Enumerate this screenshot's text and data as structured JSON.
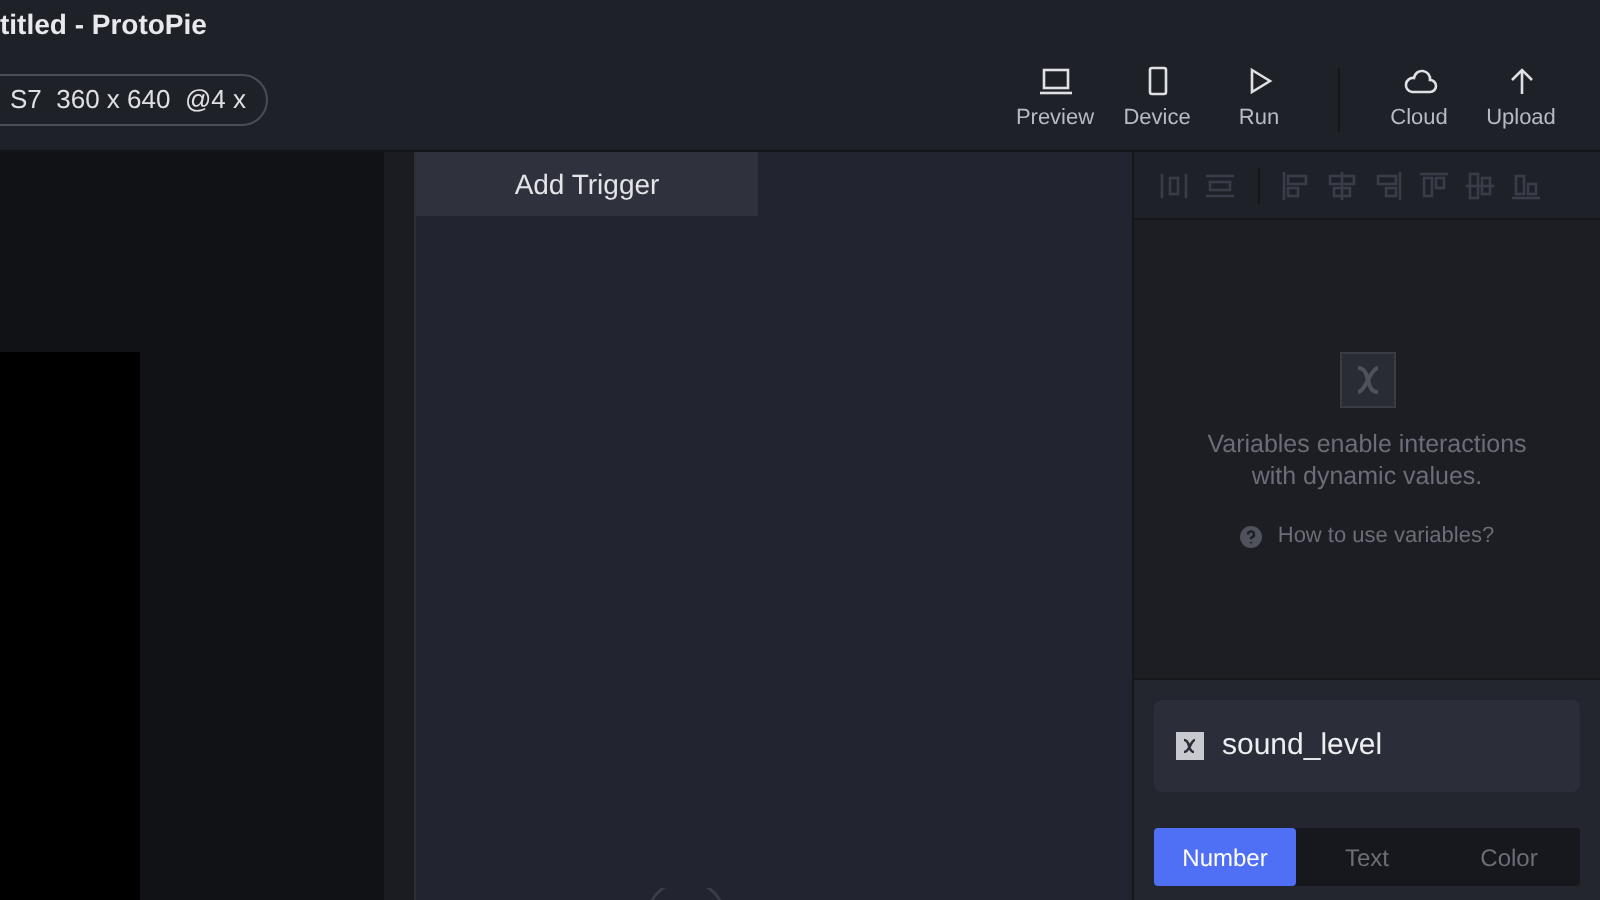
{
  "window": {
    "title": "titled - ProtoPie"
  },
  "device": {
    "label": "S7  360 x 640  @4 x"
  },
  "toolbar": [
    {
      "kind": "preview",
      "label": "Preview"
    },
    {
      "kind": "device",
      "label": "Device"
    },
    {
      "kind": "run",
      "label": "Run"
    },
    {
      "kind": "divider"
    },
    {
      "kind": "cloud",
      "label": "Cloud"
    },
    {
      "kind": "upload",
      "label": "Upload"
    }
  ],
  "triggers": {
    "add_button": "Add Trigger"
  },
  "align_tools": [
    {
      "kind": "distribute-h",
      "disabled": true
    },
    {
      "kind": "distribute-v",
      "disabled": true
    },
    {
      "kind": "divider"
    },
    {
      "kind": "left",
      "disabled": true
    },
    {
      "kind": "center-h",
      "disabled": true
    },
    {
      "kind": "right",
      "disabled": true
    },
    {
      "kind": "top",
      "disabled": true
    },
    {
      "kind": "center-v",
      "disabled": true
    },
    {
      "kind": "bottom",
      "disabled": true
    }
  ],
  "variables": {
    "empty_text": "Variables enable interactions with dynamic values.",
    "help_link": "How to use variables?",
    "variable_name": "sound_level",
    "types": [
      {
        "label": "Number",
        "selected": true
      },
      {
        "label": "Text",
        "selected": false
      },
      {
        "label": "Color",
        "selected": false
      }
    ]
  }
}
